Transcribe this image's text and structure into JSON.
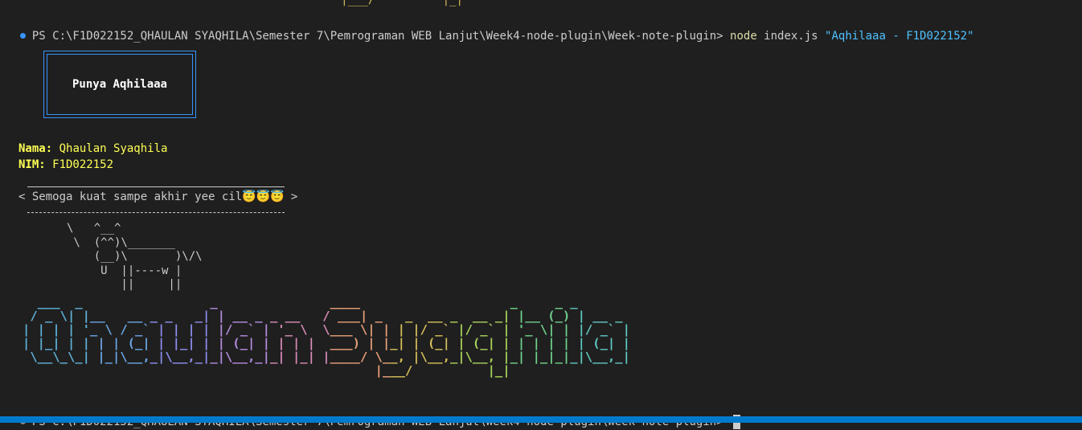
{
  "terminal": {
    "prompt_path": "PS C:\\F1D022152_QHAULAN SYAQHILA\\Semester 7\\Pemrograman WEB Lanjut\\Week4-node-plugin\\Week-note-plugin> ",
    "command": "node",
    "script": " index.js ",
    "argument": "\"Aqhilaaa - F1D022152\""
  },
  "boxen": {
    "text": "Punya Aqhilaaa"
  },
  "info": {
    "nama_label": "Nama:",
    "nama_value": " Qhaulan Syaqhila",
    "nim_label": "NIM:",
    "nim_value": " F1D022152"
  },
  "cowsay": {
    "message": "< Semoga kuat sampe akhir yee cil😇😇😇 >",
    "cow": "       \\   ^__^\n        \\  (^^)\\_______\n           (__)\\       )\\/\\\n            U  ||----w |\n               ||     ||"
  },
  "figlet": {
    "text": "Qhaulan Syaqhila",
    "rows": [
      "  ___  _                 _               ____                    _     _ _       ",
      " / _ \\| |__   __ _ _   _| | __ _ _ __   / ___| _   _  __ _  __ _| |__ (_) | __ _ ",
      "| | | | '_ \\ / _` | | | | |/ _` | '_ \\  \\___ \\| | | |/ _` |/ _` | '_ \\| | |/ _` |",
      "| |_| | | | | (_| | |_| | | (_| | | | |  ___) | |_| | (_| | (_| | | | | | | (_| |",
      " \\__\\_\\_| |_|\\__,_|\\__,_|_|\\__,_|_| |_| |____/ \\__, |\\__,_|\\__, |_| |_|_|_|\\__,_|",
      "                                               |___/          |_|                "
    ],
    "colors": [
      "#5fb0d8",
      "#6aa6e6",
      "#8e8ff0",
      "#b48ce0",
      "#d98bb8",
      "#e8a07a",
      "#d6c05a",
      "#a9d45a",
      "#6fd08a",
      "#5fc7c0"
    ]
  },
  "scrollback_top": "                                               |___/          |_|",
  "colors": {
    "accent": "#3794ff",
    "string": "#4fc1ff",
    "command": "#dcdcaa",
    "yellow": "#ffff55"
  }
}
